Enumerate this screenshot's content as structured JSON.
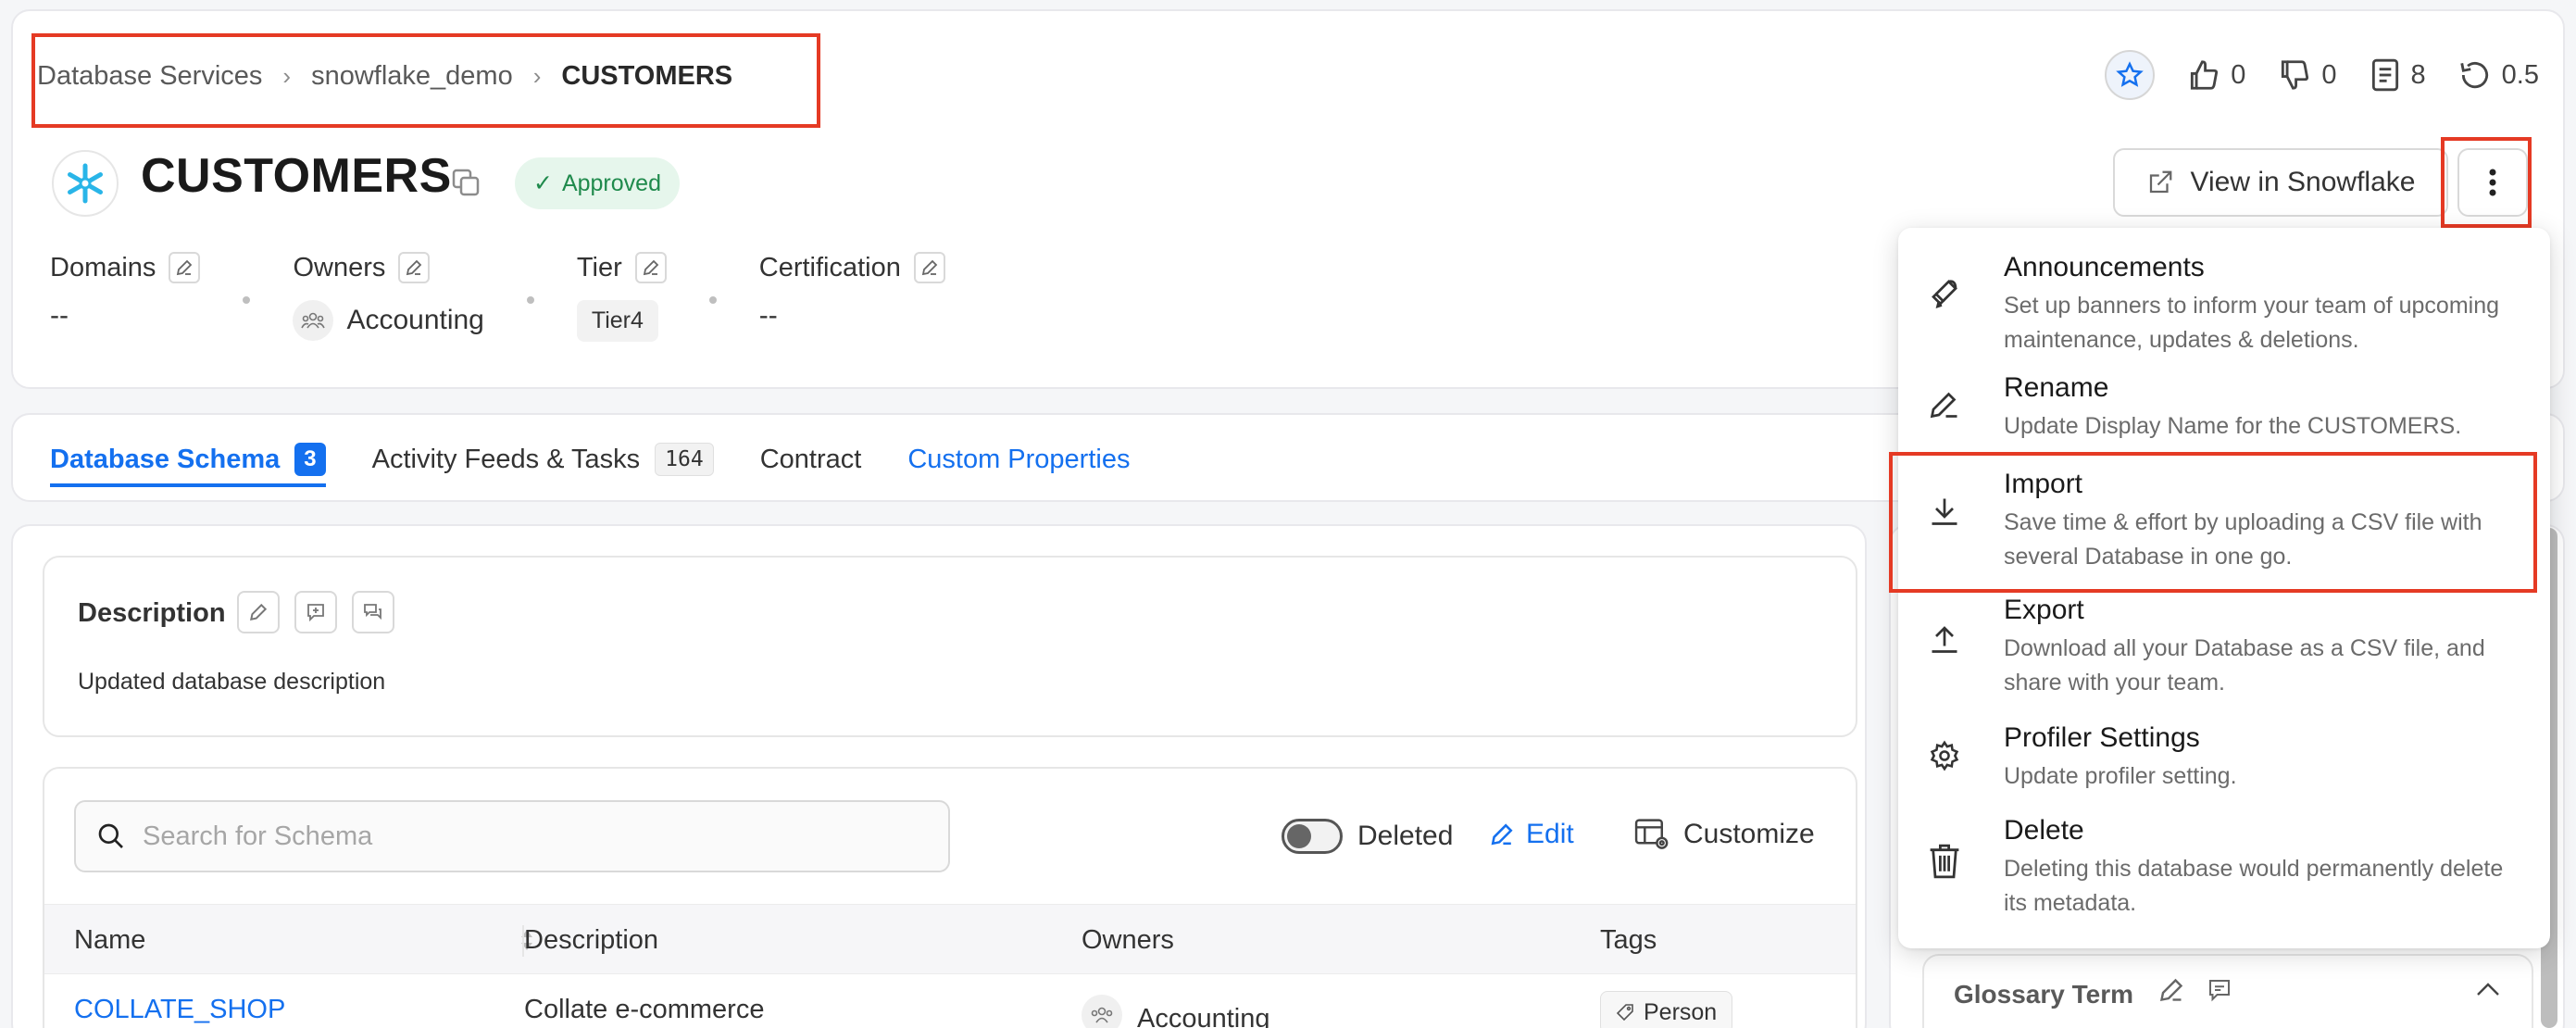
{
  "breadcrumb": {
    "items": [
      "Database Services",
      "snowflake_demo",
      "CUSTOMERS"
    ]
  },
  "entity": {
    "title": "CUSTOMERS",
    "status": "Approved"
  },
  "meta": {
    "domains": {
      "label": "Domains",
      "value": "--"
    },
    "owners": {
      "label": "Owners",
      "value": "Accounting"
    },
    "tier": {
      "label": "Tier",
      "value": "Tier4"
    },
    "certification": {
      "label": "Certification",
      "value": "--"
    }
  },
  "top_actions": {
    "likes": "0",
    "dislikes": "0",
    "tasks": "8",
    "version": "0.5"
  },
  "view_button": "View in Snowflake",
  "tabs": [
    {
      "label": "Database Schema",
      "count": "3"
    },
    {
      "label": "Activity Feeds & Tasks",
      "count": "164"
    },
    {
      "label": "Contract"
    },
    {
      "label": "Custom Properties"
    }
  ],
  "description": {
    "title": "Description",
    "text": "Updated database description"
  },
  "schema": {
    "search_placeholder": "Search for Schema",
    "deleted_label": "Deleted",
    "edit_label": "Edit",
    "customize_label": "Customize",
    "columns": [
      "Name",
      "Description",
      "Owners",
      "Tags"
    ],
    "rows": [
      {
        "name": "COLLATE_SHOP",
        "description": "Collate e-commerce",
        "owner": "Accounting",
        "tag": "Person"
      }
    ]
  },
  "glossary": {
    "title": "Glossary Term"
  },
  "menu": [
    {
      "icon": "megaphone-icon",
      "title": "Announcements",
      "desc": "Set up banners to inform your team of upcoming maintenance, updates & deletions."
    },
    {
      "icon": "pencil-icon",
      "title": "Rename",
      "desc": "Update Display Name for the CUSTOMERS."
    },
    {
      "icon": "download-icon",
      "title": "Import",
      "desc": "Save time & effort by uploading a CSV file with several Database in one go."
    },
    {
      "icon": "upload-icon",
      "title": "Export",
      "desc": "Download all your Database as a CSV file, and share with your team."
    },
    {
      "icon": "gear-icon",
      "title": "Profiler Settings",
      "desc": "Update profiler setting."
    },
    {
      "icon": "trash-icon",
      "title": "Delete",
      "desc": "Deleting this database would permanently delete its metadata."
    }
  ],
  "colors": {
    "accent": "#1470ef",
    "highlight": "#e53a24",
    "approved": "#1f8a4c"
  }
}
